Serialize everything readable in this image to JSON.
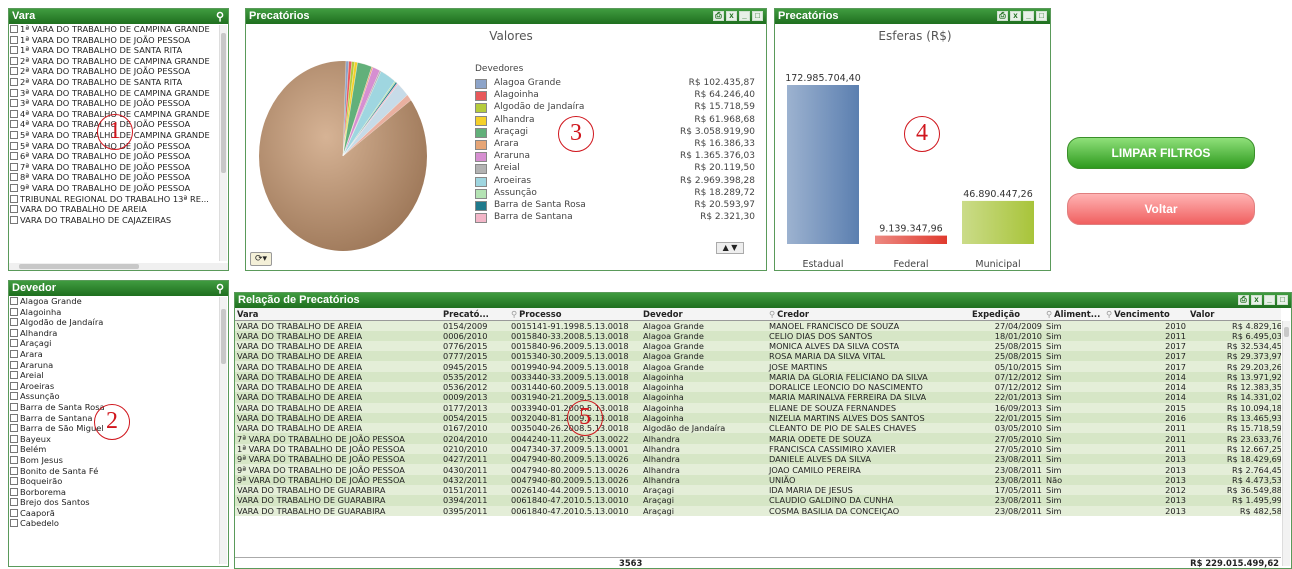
{
  "vara": {
    "title": "Vara",
    "items": [
      "1ª VARA DO TRABALHO DE CAMPINA GRANDE",
      "1ª VARA DO TRABALHO DE JOÃO PESSOA",
      "1ª VARA DO TRABALHO DE SANTA RITA",
      "2ª VARA DO TRABALHO DE CAMPINA GRANDE",
      "2ª VARA DO TRABALHO DE JOÃO PESSOA",
      "2ª VARA DO TRABALHO DE SANTA RITA",
      "3ª VARA DO TRABALHO DE CAMPINA GRANDE",
      "3ª VARA DO TRABALHO DE JOÃO PESSOA",
      "4ª VARA DO TRABALHO DE CAMPINA GRANDE",
      "4ª VARA DO TRABALHO DE JOÃO PESSOA",
      "5ª VARA DO TRABALHO DE CAMPINA GRANDE",
      "5ª VARA DO TRABALHO DE JOÃO PESSOA",
      "6ª VARA DO TRABALHO DE JOÃO PESSOA",
      "7ª VARA DO TRABALHO DE JOÃO PESSOA",
      "8ª VARA DO TRABALHO DE JOÃO PESSOA",
      "9ª VARA DO TRABALHO DE JOÃO PESSOA",
      "TRIBUNAL REGIONAL DO TRABALHO 13ª RE...",
      "VARA DO TRABALHO DE AREIA",
      "VARA DO TRABALHO DE CAJAZEIRAS"
    ]
  },
  "devedor": {
    "title": "Devedor",
    "items": [
      "Alagoa Grande",
      "Alagoinha",
      "Algodão de Jandaíra",
      "Alhandra",
      "Araçagi",
      "Arara",
      "Araruna",
      "Areial",
      "Aroeiras",
      "Assunção",
      "Barra de Santa Rosa",
      "Barra de Santana",
      "Barra de São Miguel",
      "Bayeux",
      "Belém",
      "Bom Jesus",
      "Bonito de Santa Fé",
      "Boqueirão",
      "Borborema",
      "Brejo dos Santos",
      "Caaporã",
      "Cabedelo"
    ]
  },
  "valores": {
    "panel_title": "Precatórios",
    "title": "Valores",
    "legend_title": "Devedores",
    "legend": [
      {
        "name": "Alagoa Grande",
        "value": "R$ 102.435,87",
        "color": "#8da4c9"
      },
      {
        "name": "Alagoinha",
        "value": "R$ 64.246,40",
        "color": "#e8585a"
      },
      {
        "name": "Algodão de Jandaíra",
        "value": "R$ 15.718,59",
        "color": "#b5cc3c"
      },
      {
        "name": "Alhandra",
        "value": "R$ 61.968,68",
        "color": "#f5d02a"
      },
      {
        "name": "Araçagi",
        "value": "R$ 3.058.919,90",
        "color": "#62b07a"
      },
      {
        "name": "Arara",
        "value": "R$ 16.386,33",
        "color": "#e6a576"
      },
      {
        "name": "Araruna",
        "value": "R$ 1.365.376,03",
        "color": "#d68fd1"
      },
      {
        "name": "Areial",
        "value": "R$ 20.119,50",
        "color": "#b2b2b2"
      },
      {
        "name": "Aroeiras",
        "value": "R$ 2.969.398,28",
        "color": "#9fd6e0"
      },
      {
        "name": "Assunção",
        "value": "R$ 18.289,72",
        "color": "#b4e3b4"
      },
      {
        "name": "Barra de Santa Rosa",
        "value": "R$ 20.593,97",
        "color": "#1f7a8c"
      },
      {
        "name": "Barra de Santana",
        "value": "R$ 2.321,30",
        "color": "#f3b6c8"
      }
    ]
  },
  "esferas": {
    "panel_title": "Precatórios",
    "title": "Esferas (R$)"
  },
  "chart_data": [
    {
      "type": "bar",
      "title": "Esferas (R$)",
      "categories": [
        "Estadual",
        "Federal",
        "Municipal"
      ],
      "values": [
        172985704.4,
        9139347.96,
        46890447.26
      ],
      "labels": [
        "172.985.704,40",
        "9.139.347,96",
        "46.890.447,26"
      ],
      "colors": [
        "#5b7fb0",
        "#e03a2e",
        "#a8c43a"
      ]
    }
  ],
  "buttons": {
    "limpar": "LIMPAR FILTROS",
    "voltar": "Voltar"
  },
  "markers": {
    "m1": "1",
    "m2": "2",
    "m3": "3",
    "m4": "4",
    "m5": "5"
  },
  "relacao": {
    "title": "Relação de Precatórios",
    "columns": [
      "Vara",
      "Precató...",
      "Processo",
      "Devedor",
      "Credor",
      "Expedição",
      "Aliment...",
      "Vencimento",
      "Valor"
    ],
    "rows": [
      [
        "VARA DO TRABALHO DE AREIA",
        "0154/2009",
        "0015141-91.1998.5.13.0018",
        "Alagoa Grande",
        "MANOEL FRANCISCO DE SOUZA",
        "27/04/2009",
        "Sim",
        "2010",
        "R$ 4.829,16"
      ],
      [
        "VARA DO TRABALHO DE AREIA",
        "0006/2010",
        "0015840-33.2008.5.13.0018",
        "Alagoa Grande",
        "CELIO DIAS DOS SANTOS",
        "18/01/2010",
        "Sim",
        "2011",
        "R$ 6.495,03"
      ],
      [
        "VARA DO TRABALHO DE AREIA",
        "0776/2015",
        "0015840-96.2009.5.13.0018",
        "Alagoa Grande",
        "MONICA ALVES DA SILVA COSTA",
        "25/08/2015",
        "Sim",
        "2017",
        "R$ 32.534,45"
      ],
      [
        "VARA DO TRABALHO DE AREIA",
        "0777/2015",
        "0015340-30.2009.5.13.0018",
        "Alagoa Grande",
        "ROSA MARIA DA SILVA VITAL",
        "25/08/2015",
        "Sim",
        "2017",
        "R$ 29.373,97"
      ],
      [
        "VARA DO TRABALHO DE AREIA",
        "0945/2015",
        "0019940-94.2009.5.13.0018",
        "Alagoa Grande",
        "JOSE MARTINS",
        "05/10/2015",
        "Sim",
        "2017",
        "R$ 29.203,26"
      ],
      [
        "VARA DO TRABALHO DE AREIA",
        "0535/2012",
        "0033440-33.2009.5.13.0018",
        "Alagoinha",
        "MARIA DA GLORIA FELICIANO DA SILVA",
        "07/12/2012",
        "Sim",
        "2014",
        "R$ 13.971,92"
      ],
      [
        "VARA DO TRABALHO DE AREIA",
        "0536/2012",
        "0031440-60.2009.5.13.0018",
        "Alagoinha",
        "DORALICE LEONCIO DO NASCIMENTO",
        "07/12/2012",
        "Sim",
        "2014",
        "R$ 12.383,35"
      ],
      [
        "VARA DO TRABALHO DE AREIA",
        "0009/2013",
        "0031940-21.2009.5.13.0018",
        "Alagoinha",
        "MARIA MARINALVA FERREIRA DA SILVA",
        "22/01/2013",
        "Sim",
        "2014",
        "R$ 14.331,02"
      ],
      [
        "VARA DO TRABALHO DE AREIA",
        "0177/2013",
        "0033940-01.2009.5.13.0018",
        "Alagoinha",
        "ELIANE DE SOUZA FERNANDES",
        "16/09/2013",
        "Sim",
        "2015",
        "R$ 10.094,18"
      ],
      [
        "VARA DO TRABALHO DE AREIA",
        "0054/2015",
        "0032040-81.2009.5.13.0018",
        "Alagoinha",
        "NIZELIA MARTINS ALVES DOS SANTOS",
        "22/01/2015",
        "Sim",
        "2016",
        "R$ 13.465,93"
      ],
      [
        "VARA DO TRABALHO DE AREIA",
        "0167/2010",
        "0035040-26.2008.5.13.0018",
        "Algodão de Jandaíra",
        "CLEANTO DE PIO DE SALES CHAVES",
        "03/05/2010",
        "Sim",
        "2011",
        "R$ 15.718,59"
      ],
      [
        "7ª VARA DO TRABALHO DE JOÃO PESSOA",
        "0204/2010",
        "0044240-11.2009.5.13.0022",
        "Alhandra",
        "MARIA ODETE DE SOUZA",
        "27/05/2010",
        "Sim",
        "2011",
        "R$ 23.633,76"
      ],
      [
        "1ª VARA DO TRABALHO DE JOÃO PESSOA",
        "0210/2010",
        "0047340-37.2009.5.13.0001",
        "Alhandra",
        "FRANCISCA CASSIMIRO XAVIER",
        "27/05/2010",
        "Sim",
        "2011",
        "R$ 12.667,25"
      ],
      [
        "9ª VARA DO TRABALHO DE JOÃO PESSOA",
        "0427/2011",
        "0047940-80.2009.5.13.0026",
        "Alhandra",
        "DANIELE ALVES DA SILVA",
        "23/08/2011",
        "Sim",
        "2013",
        "R$ 18.429,69"
      ],
      [
        "9ª VARA DO TRABALHO DE JOÃO PESSOA",
        "0430/2011",
        "0047940-80.2009.5.13.0026",
        "Alhandra",
        "JOAO CAMILO PEREIRA",
        "23/08/2011",
        "Sim",
        "2013",
        "R$ 2.764,45"
      ],
      [
        "9ª VARA DO TRABALHO DE JOÃO PESSOA",
        "0432/2011",
        "0047940-80.2009.5.13.0026",
        "Alhandra",
        "UNIÃO",
        "23/08/2011",
        "Não",
        "2013",
        "R$ 4.473,53"
      ],
      [
        "VARA DO TRABALHO DE GUARABIRA",
        "0151/2011",
        "0026140-44.2009.5.13.0010",
        "Araçagi",
        "IDA MARIA DE JESUS",
        "17/05/2011",
        "Sim",
        "2012",
        "R$ 36.549,88"
      ],
      [
        "VARA DO TRABALHO DE GUARABIRA",
        "0394/2011",
        "0061840-47.2010.5.13.0010",
        "Araçagi",
        "CLAUDIO GALDINO DA CUNHA",
        "23/08/2011",
        "Sim",
        "2013",
        "R$ 1.495,99"
      ],
      [
        "VARA DO TRABALHO DE GUARABIRA",
        "0395/2011",
        "0061840-47.2010.5.13.0010",
        "Araçagi",
        "COSMA BASILIA DA CONCEIÇAO",
        "23/08/2011",
        "Sim",
        "2013",
        "R$ 482,58"
      ]
    ],
    "total_count": "3563",
    "total_value": "R$ 229.015.499,62"
  }
}
